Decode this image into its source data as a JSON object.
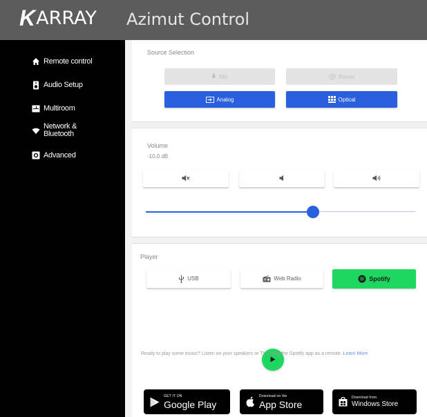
{
  "header": {
    "logo_k": "K",
    "logo_rest": "ARRAY",
    "app_title": "Azimut Control"
  },
  "sidebar": {
    "items": [
      {
        "label": "Remote control",
        "icon": "home-icon"
      },
      {
        "label": "Audio Setup",
        "icon": "speaker-icon"
      },
      {
        "label": "Multiroom",
        "icon": "multiroom-icon"
      },
      {
        "label": "Network &",
        "label2": "Bluetooth",
        "icon": "wifi-icon"
      },
      {
        "label": "Advanced",
        "icon": "gear-icon"
      }
    ]
  },
  "source": {
    "title": "Source Selection",
    "buttons": [
      {
        "label": "Mic",
        "icon": "mic-icon",
        "state": "disabled"
      },
      {
        "label": "Preset",
        "icon": "preset-icon",
        "state": "disabled"
      },
      {
        "label": "Analog",
        "icon": "analog-input-icon",
        "state": "active"
      },
      {
        "label": "Optical",
        "icon": "optical-icon",
        "state": "active"
      }
    ]
  },
  "volume": {
    "title": "Volume",
    "value_text": "-10.0 dB",
    "buttons": [
      {
        "icon": "mute-icon"
      },
      {
        "icon": "volume-down-icon"
      },
      {
        "icon": "volume-up-icon"
      }
    ],
    "level_fraction": 0.62
  },
  "player": {
    "title": "Player",
    "buttons": [
      {
        "label": "USB",
        "icon": "usb-icon"
      },
      {
        "label": "Web Radio",
        "icon": "radio-icon"
      },
      {
        "label": "Spotify",
        "icon": "spotify-icon"
      }
    ],
    "play_icon": "play-icon",
    "promo_text": "Ready to play some music? Listen on your speakers or TV, using the Spotify app as a remote.",
    "promo_link": "Learn More",
    "stores": [
      {
        "small": "GET IT ON",
        "big": "Google Play",
        "icon": "google-play-icon"
      },
      {
        "small": "Download on the",
        "big": "App Store",
        "icon": "apple-icon"
      },
      {
        "small": "Download from",
        "big": "Windows Store",
        "icon": "windows-icon"
      }
    ]
  },
  "colors": {
    "accent": "#2a5fe0",
    "spotify": "#1ed760",
    "header": "#5c5c5c",
    "sidebar": "#000000"
  }
}
